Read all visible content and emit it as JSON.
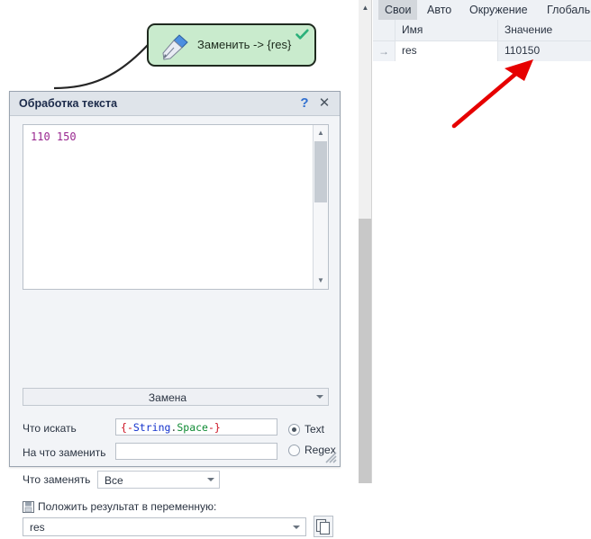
{
  "node": {
    "label": "Заменить -> {res}",
    "icon": "pen-nib-icon",
    "status_icon": "check-icon",
    "fill_color": "#c9ebcd",
    "border_color": "#1f2a1f"
  },
  "dialog": {
    "title": "Обработка текста",
    "help_label": "?",
    "close_label": "✕",
    "textarea": {
      "value": "110 150",
      "text_color": "#99278f"
    },
    "mode_combo": {
      "value": "Замена"
    },
    "find": {
      "label": "Что искать",
      "value": "{-String.Space-}",
      "tokens": [
        {
          "t": "{",
          "cls": "tk-brace"
        },
        {
          "t": "-",
          "cls": "tk-dash"
        },
        {
          "t": "String",
          "cls": "tk-ns"
        },
        {
          "t": ".",
          "cls": "tk-dot"
        },
        {
          "t": "Space",
          "cls": "tk-mem"
        },
        {
          "t": "-",
          "cls": "tk-dash"
        },
        {
          "t": "}",
          "cls": "tk-brace"
        }
      ]
    },
    "replace": {
      "label": "На что заменить",
      "value": "",
      "placeholder": ""
    },
    "what_to_replace": {
      "label": "Что заменять",
      "value": "Все"
    },
    "match_mode": {
      "text_label": "Text",
      "regex_label": "Regex",
      "selected": "Text"
    },
    "result": {
      "icon": "save-icon",
      "label": "Положить результат в переменную:",
      "value": "res",
      "copy_icon": "copy-icon"
    },
    "resize_grip": "resize-grip-icon"
  },
  "variables_panel": {
    "tabs": [
      {
        "label": "Свои",
        "selected": true
      },
      {
        "label": "Авто",
        "selected": false
      },
      {
        "label": "Окружение",
        "selected": false
      },
      {
        "label": "Глобальные",
        "selected": false
      }
    ],
    "columns": [
      "",
      "Имя",
      "Значение"
    ],
    "rows": [
      {
        "marker": "→",
        "name": "res",
        "value": "110150"
      }
    ]
  },
  "annotation": {
    "arrow_color": "#e60000",
    "arrow_name": "red-pointer-arrow"
  },
  "scrollbars": {
    "page_up_arrow": "▲",
    "textarea_up_arrow": "▲",
    "textarea_down_arrow": "▼"
  }
}
